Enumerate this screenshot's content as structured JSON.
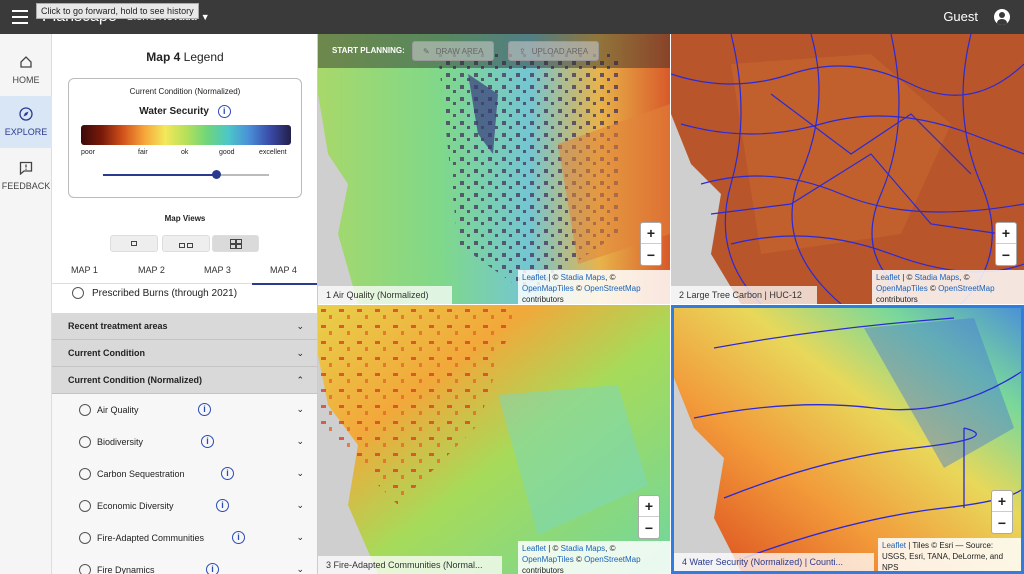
{
  "tooltip": "Click to go forward, hold to see history",
  "app": {
    "brand": "Planscape",
    "region": "Sierra Nevada",
    "user": "Guest"
  },
  "nav": [
    {
      "label": "HOME",
      "icon": "home-icon"
    },
    {
      "label": "EXPLORE",
      "icon": "compass-icon",
      "active": true
    },
    {
      "label": "FEEDBACK",
      "icon": "feedback-icon"
    }
  ],
  "legend": {
    "title_bold": "Map 4",
    "title_rest": "Legend",
    "subtitle": "Current Condition (Normalized)",
    "layer": "Water Security",
    "scale_labels": [
      "poor",
      "fair",
      "ok",
      "good",
      "excellent"
    ],
    "opacity": 0.68
  },
  "map_views": {
    "title": "Map Views",
    "selected": 3
  },
  "tabs": [
    "MAP 1",
    "MAP 2",
    "MAP 3",
    "MAP 4"
  ],
  "active_tab": "MAP 4",
  "prescribed": "Prescribed Burns (through 2021)",
  "sections": [
    {
      "label": "Recent treatment areas",
      "chevron": "⌄"
    },
    {
      "label": "Current Condition",
      "chevron": "⌄"
    },
    {
      "label": "Current Condition (Normalized)",
      "chevron": "⌃"
    }
  ],
  "layers": [
    {
      "label": "Air Quality"
    },
    {
      "label": "Biodiversity"
    },
    {
      "label": "Carbon Sequestration"
    },
    {
      "label": "Economic Diversity"
    },
    {
      "label": "Fire-Adapted Communities"
    },
    {
      "label": "Fire Dynamics"
    }
  ],
  "planning": {
    "label": "START PLANNING:",
    "draw": "DRAW AREA",
    "upload": "UPLOAD AREA"
  },
  "maps": [
    {
      "label": "1   Air Quality (Normalized)"
    },
    {
      "label": "2   Large Tree Carbon | HUC-12"
    },
    {
      "label": "3   Fire-Adapted Communities (Normal..."
    },
    {
      "label": "4   Water Security (Normalized) | Counti..."
    }
  ],
  "attribution": {
    "leaflet": "Leaflet",
    "stadia": "Stadia Maps",
    "omt": "OpenMapTiles",
    "osm": "OpenStreetMap",
    "contributors": "contributors",
    "esri": "| Tiles © Esri — Source: USGS, Esri, TANA, DeLorme, and NPS"
  },
  "zoom": {
    "in": "+",
    "out": "−"
  },
  "colors": {
    "topbar": "#3a3a3a",
    "accent": "#2a3b8f",
    "active_map_border": "#2f7de1"
  }
}
